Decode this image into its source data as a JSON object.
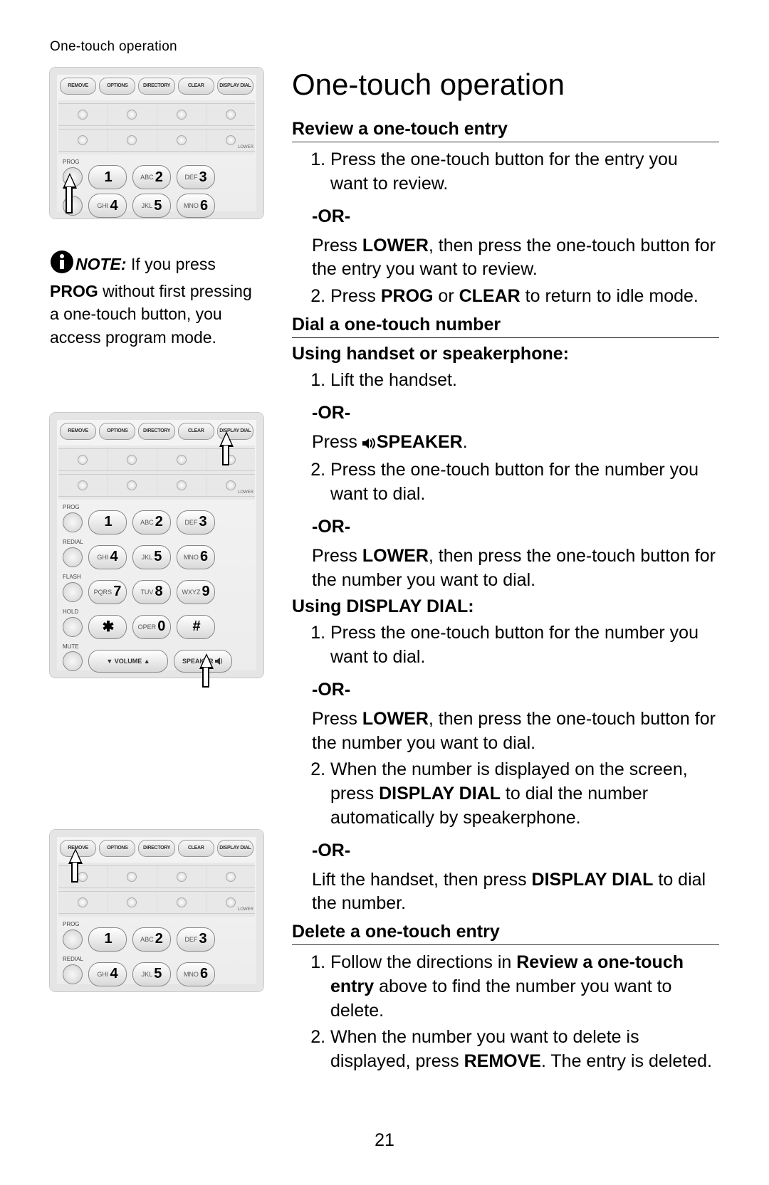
{
  "runningHead": "One-touch operation",
  "title": "One-touch operation",
  "pageNumber": "21",
  "note": {
    "label": "NOTE:",
    "text_pre": " If you press ",
    "bold1": "PROG",
    "text_post": " without first pressing a one-touch button, you access program mode."
  },
  "funcButtons": [
    "REMOVE",
    "OPTIONS",
    "DIRECTORY",
    "CLEAR",
    "DISPLAY DIAL"
  ],
  "sideLabels": {
    "prog": "PROG",
    "redial": "REDIAL",
    "flash": "FLASH",
    "hold": "HOLD",
    "mute": "MUTE",
    "lower": "LOWER"
  },
  "keys": {
    "k1": {
      "letters": "",
      "num": "1"
    },
    "k2": {
      "letters": "ABC",
      "num": "2"
    },
    "k3": {
      "letters": "DEF",
      "num": "3"
    },
    "k4": {
      "letters": "GHI",
      "num": "4"
    },
    "k5": {
      "letters": "JKL",
      "num": "5"
    },
    "k6": {
      "letters": "MNO",
      "num": "6"
    },
    "k7": {
      "letters": "PQRS",
      "num": "7"
    },
    "k8": {
      "letters": "TUV",
      "num": "8"
    },
    "k9": {
      "letters": "WXYZ",
      "num": "9"
    },
    "kstar": {
      "letters": "",
      "num": "✱"
    },
    "k0": {
      "letters": "OPER",
      "num": "0"
    },
    "khash": {
      "letters": "",
      "num": "#"
    }
  },
  "volume": "▼  VOLUME  ▲",
  "speaker": "SPEAKER",
  "sections": {
    "review": {
      "head": "Review a one-touch entry",
      "li1": "Press the one-touch button for the entry you want to review.",
      "or": "-OR-",
      "orText_pre": "Press ",
      "orText_bold": "LOWER",
      "orText_post": ", then press the one-touch button for the entry you want to review.",
      "li2_pre": "Press ",
      "li2_b1": "PROG",
      "li2_mid": " or ",
      "li2_b2": "CLEAR",
      "li2_post": " to return to idle mode."
    },
    "dial": {
      "head": "Dial a one-touch number",
      "sub1": "Using handset or speakerphone:",
      "s1_li1": "Lift the handset.",
      "or": "-OR-",
      "s1_or1_pre": "Press ",
      "s1_or1_bold": "SPEAKER",
      "s1_or1_post": ".",
      "s1_li2": "Press the one-touch button for the number you want to dial.",
      "s1_or2_pre": "Press ",
      "s1_or2_bold": "LOWER",
      "s1_or2_post": ", then press the one-touch button for the number you want to dial.",
      "sub2": "Using DISPLAY DIAL:",
      "s2_li1": "Press the one-touch button for the number you want to dial.",
      "s2_or1_pre": "Press ",
      "s2_or1_bold": "LOWER",
      "s2_or1_post": ", then press the one-touch button for the number you want to dial.",
      "s2_li2_pre": "When the number is displayed on the screen, press ",
      "s2_li2_bold": "DISPLAY DIAL",
      "s2_li2_post": " to dial the number automatically by speakerphone.",
      "s2_or2_pre": "Lift the handset, then press ",
      "s2_or2_bold": "DISPLAY DIAL",
      "s2_or2_post": " to dial the number."
    },
    "delete": {
      "head": "Delete a one-touch entry",
      "li1_pre": "Follow the directions in ",
      "li1_bold": "Review a one-touch entry",
      "li1_post": " above to find the number you want to delete.",
      "li2_pre": "When the number you want to delete is displayed, press ",
      "li2_bold": "REMOVE",
      "li2_post": ". The entry is deleted."
    }
  }
}
